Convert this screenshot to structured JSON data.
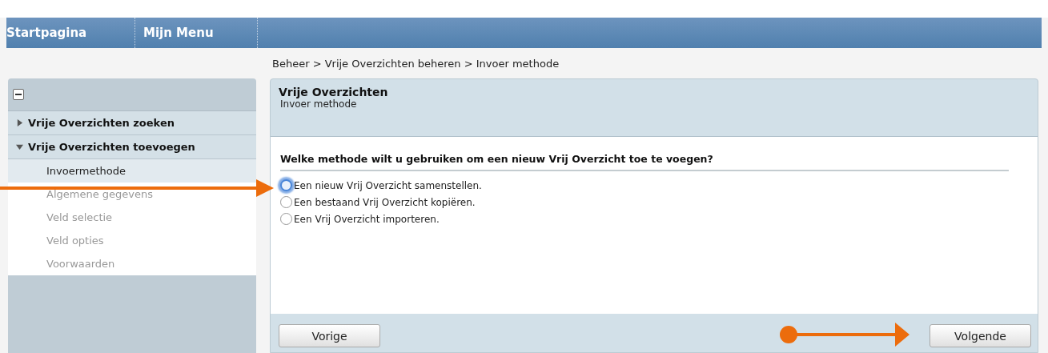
{
  "nav": {
    "items": [
      {
        "label": "Startpagina"
      },
      {
        "label": "Mijn Menu"
      }
    ]
  },
  "breadcrumb": "Beheer > Vrije Overzichten beheren > Invoer methode",
  "sidebar": {
    "sections": [
      {
        "label": "Vrije Overzichten zoeken",
        "expanded": false
      },
      {
        "label": "Vrije Overzichten toevoegen",
        "expanded": true,
        "children": [
          {
            "label": "Invoermethode",
            "selected": true,
            "disabled": false
          },
          {
            "label": "Algemene gegevens",
            "selected": false,
            "disabled": true
          },
          {
            "label": "Veld selectie",
            "selected": false,
            "disabled": true
          },
          {
            "label": "Veld opties",
            "selected": false,
            "disabled": true
          },
          {
            "label": "Voorwaarden",
            "selected": false,
            "disabled": true
          }
        ]
      }
    ]
  },
  "panel": {
    "title": "Vrije Overzichten",
    "subtitle": "Invoer methode",
    "question": "Welke methode wilt u gebruiken om een nieuw Vrij Overzicht toe te voegen?",
    "options": [
      {
        "label": "Een nieuw Vrij Overzicht samenstellen.",
        "selected": false,
        "focused": true
      },
      {
        "label": "Een bestaand Vrij Overzicht kopiëren.",
        "selected": false,
        "focused": false
      },
      {
        "label": "Een Vrij Overzicht importeren.",
        "selected": false,
        "focused": false
      }
    ],
    "buttons": [
      {
        "label": "Vorige"
      },
      {
        "label": "Volgende"
      }
    ]
  }
}
